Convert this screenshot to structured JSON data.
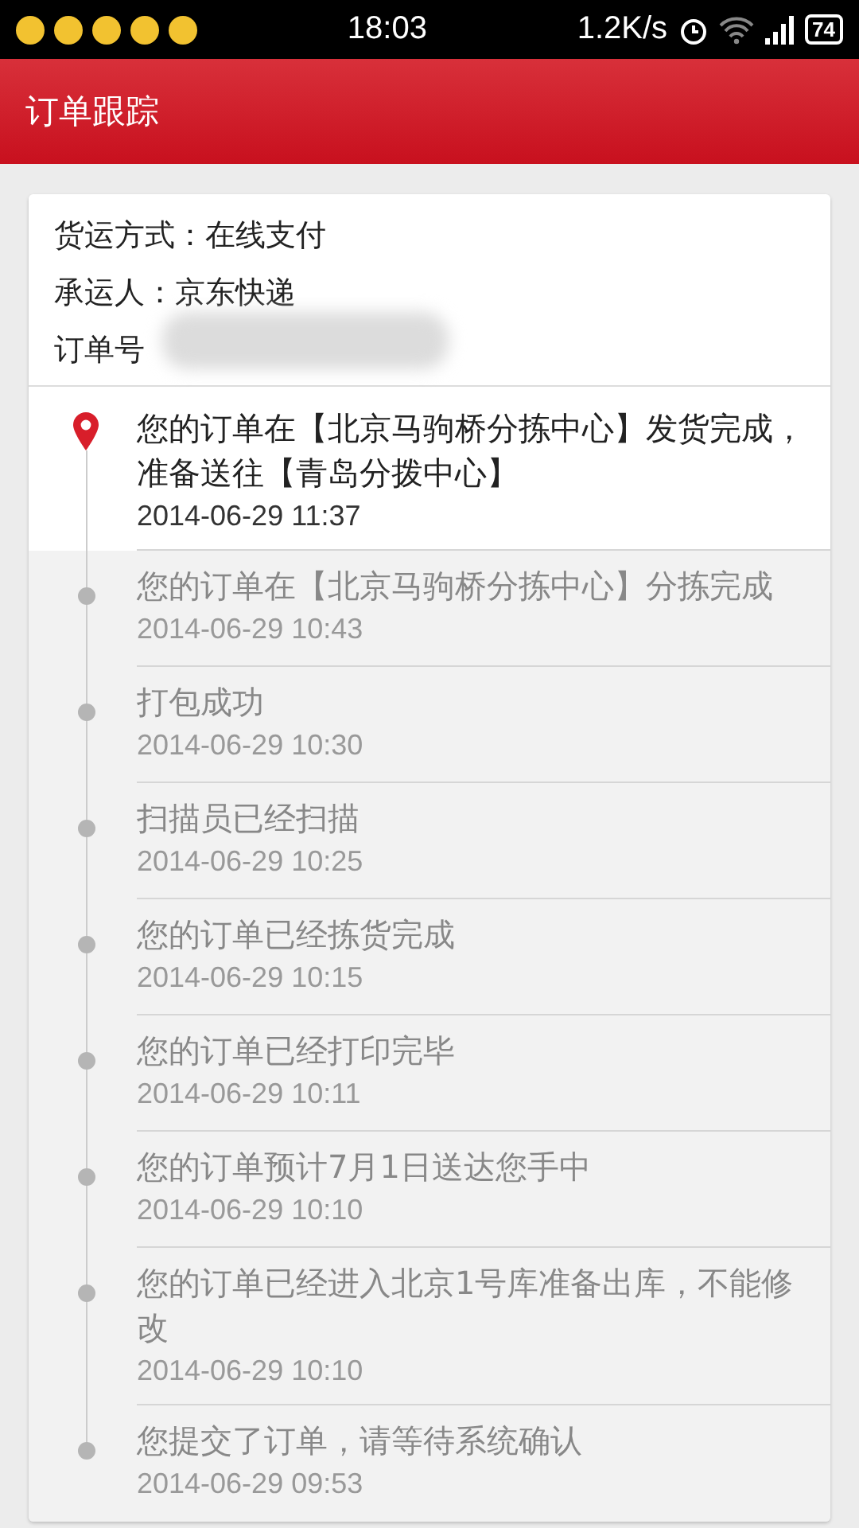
{
  "status_bar": {
    "time": "18:03",
    "speed": "1.2K/s",
    "battery": "74"
  },
  "header": {
    "title": "订单跟踪"
  },
  "info": [
    {
      "label": "货运方式：在线支付"
    },
    {
      "label": "承运人：京东快递"
    },
    {
      "label": "订单号",
      "redacted": true
    }
  ],
  "events": [
    {
      "text": "您的订单在【北京马驹桥分拣中心】发货完成，准备送往【青岛分拨中心】",
      "time": "2014-06-29  11:37",
      "current": true
    },
    {
      "text": "您的订单在【北京马驹桥分拣中心】分拣完成",
      "time": "2014-06-29  10:43",
      "current": false
    },
    {
      "text": "打包成功",
      "time": "2014-06-29  10:30",
      "current": false
    },
    {
      "text": "扫描员已经扫描",
      "time": "2014-06-29  10:25",
      "current": false
    },
    {
      "text": "您的订单已经拣货完成",
      "time": "2014-06-29  10:15",
      "current": false
    },
    {
      "text": "您的订单已经打印完毕",
      "time": "2014-06-29  10:11",
      "current": false
    },
    {
      "text": "您的订单预计7月1日送达您手中",
      "time": "2014-06-29  10:10",
      "current": false
    },
    {
      "text": "您的订单已经进入北京1号库准备出库，不能修改",
      "time": "2014-06-29  10:10",
      "current": false
    },
    {
      "text": "您提交了订单，请等待系统确认",
      "time": "2014-06-29  09:53",
      "current": false
    }
  ]
}
